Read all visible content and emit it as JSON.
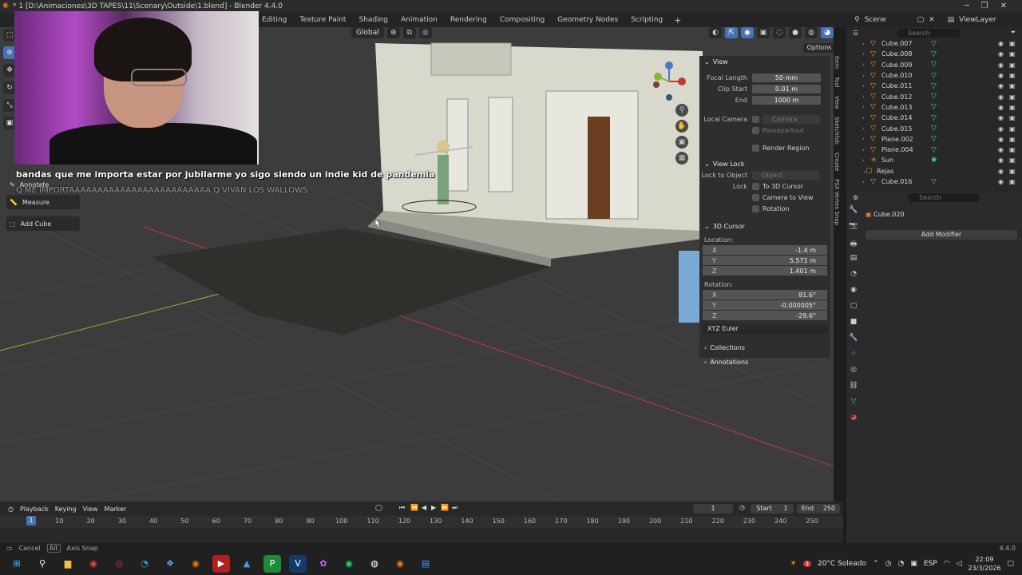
{
  "window": {
    "title": "* 1 [D:\\Animaciones\\3D TAPES\\11\\Scenary\\Outside\\1.blend] - Blender 4.4.0",
    "minimize": "─",
    "maximize": "❐",
    "close": "✕"
  },
  "workspaces": [
    "Editing",
    "Texture Paint",
    "Shading",
    "Animation",
    "Rendering",
    "Compositing",
    "Geometry Nodes",
    "Scripting"
  ],
  "workspace_add": "+",
  "scene": {
    "name": "Scene",
    "view_layer": "ViewLayer"
  },
  "viewport_header": {
    "orientation": "Global",
    "options": "Options"
  },
  "chat": {
    "line1": "bandas que me importa estar por jubilarme yo sigo siendo un indie kid de pandemia",
    "line2": "Q ME IMPORTAAAAAAAAAAAAAAAAAAAAAAAAA Q VIVAN LOS WALLOWS"
  },
  "tools": {
    "annotate": "Annotate",
    "measure": "Measure",
    "add_cube": "Add Cube"
  },
  "npanel": {
    "view_title": "View",
    "focal_length_label": "Focal Length",
    "focal_length": "50 mm",
    "clip_start_label": "Clip Start",
    "clip_start": "0.01 m",
    "end_label": "End",
    "clip_end": "1000 m",
    "local_camera_label": "Local Camera",
    "camera_placeholder": "Camera",
    "passepartout": "Passepartout",
    "render_region": "Render Region",
    "view_lock_title": "View Lock",
    "lock_to_object_label": "Lock to Object",
    "object_placeholder": "Object",
    "lock_label": "Lock",
    "to_3d_cursor": "To 3D Cursor",
    "camera_to_view": "Camera to View",
    "rotation_opt": "Rotation",
    "cursor_title": "3D Cursor",
    "location_label": "Location:",
    "loc_x": "-1.4 m",
    "loc_y": "5.571 m",
    "loc_z": "1.401 m",
    "rotation_label": "Rotation:",
    "rot_x": "81.6°",
    "rot_y": "-0.000005°",
    "rot_z": "-29.6°",
    "rotation_mode": "XYZ Euler",
    "collections": "Collections",
    "annotations": "Annotations",
    "axis_x": "X",
    "axis_y": "Y",
    "axis_z": "Z"
  },
  "ntabs": [
    "Item",
    "Tool",
    "View",
    "Sketchfab",
    "Create",
    "PSX Vertex Snap"
  ],
  "outliner": {
    "search_placeholder": "Search",
    "items": [
      {
        "name": "Cube.007"
      },
      {
        "name": "Cube.008"
      },
      {
        "name": "Cube.009"
      },
      {
        "name": "Cube.010"
      },
      {
        "name": "Cube.011"
      },
      {
        "name": "Cube.012"
      },
      {
        "name": "Cube.013"
      },
      {
        "name": "Cube.014"
      },
      {
        "name": "Cube.015"
      },
      {
        "name": "Plane.002"
      },
      {
        "name": "Plane.004"
      },
      {
        "name": "Sun"
      },
      {
        "name": "Rejas"
      },
      {
        "name": "Cube.016"
      }
    ]
  },
  "properties": {
    "search_placeholder": "Search",
    "object_name": "Cube.020",
    "add_modifier": "Add Modifier"
  },
  "timeline": {
    "playback": "Playback",
    "keying": "Keying",
    "view": "View",
    "marker": "Marker",
    "current_frame": "1",
    "start_label": "Start",
    "start": "1",
    "end_label": "End",
    "end": "250",
    "ruler": [
      "1",
      "10",
      "20",
      "30",
      "40",
      "50",
      "60",
      "70",
      "80",
      "90",
      "100",
      "110",
      "120",
      "130",
      "140",
      "150",
      "160",
      "170",
      "180",
      "190",
      "200",
      "210",
      "220",
      "230",
      "240",
      "250"
    ]
  },
  "status": {
    "cancel": "Cancel",
    "alt": "Alt",
    "axis_snap": "Axis Snap",
    "version": "4.4.0"
  },
  "taskbar": {
    "weather": "20°C Soleado",
    "lang": "ESP",
    "time": "22:09",
    "date": "23/3/2026",
    "notif": "3"
  },
  "colors": {
    "accent": "#4772b3",
    "viewport_bg": "#3c3c3c",
    "panel_bg": "#2e2e2e",
    "x_axis": "#c0393b",
    "y_axis": "#8bb33a"
  }
}
